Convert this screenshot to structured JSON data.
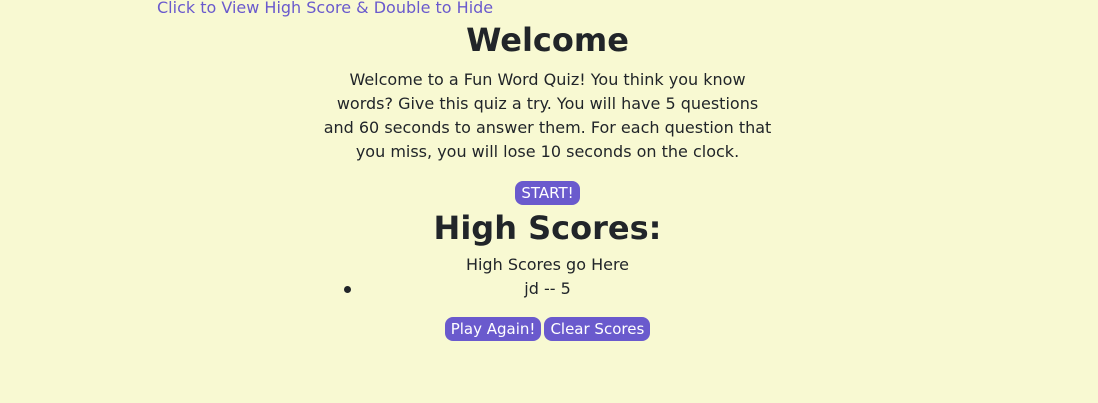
{
  "header": {
    "high_score_link": "Click to View High Score & Double to Hide"
  },
  "welcome": {
    "title": "Welcome",
    "description": "Welcome to a Fun Word Quiz! You think you know words? Give this quiz a try. You will have 5 questions and 60 seconds to answer them. For each question that you miss, you will lose 10 seconds on the clock.",
    "start_label": "START!"
  },
  "high_scores": {
    "title": "High Scores:",
    "subtitle": "High Scores go Here",
    "entries": [
      "jd -- 5"
    ],
    "play_again_label": "Play Again!",
    "clear_label": "Clear Scores"
  },
  "colors": {
    "background": "#f8f9d2",
    "accent": "#6a5acd",
    "text": "#212529"
  }
}
